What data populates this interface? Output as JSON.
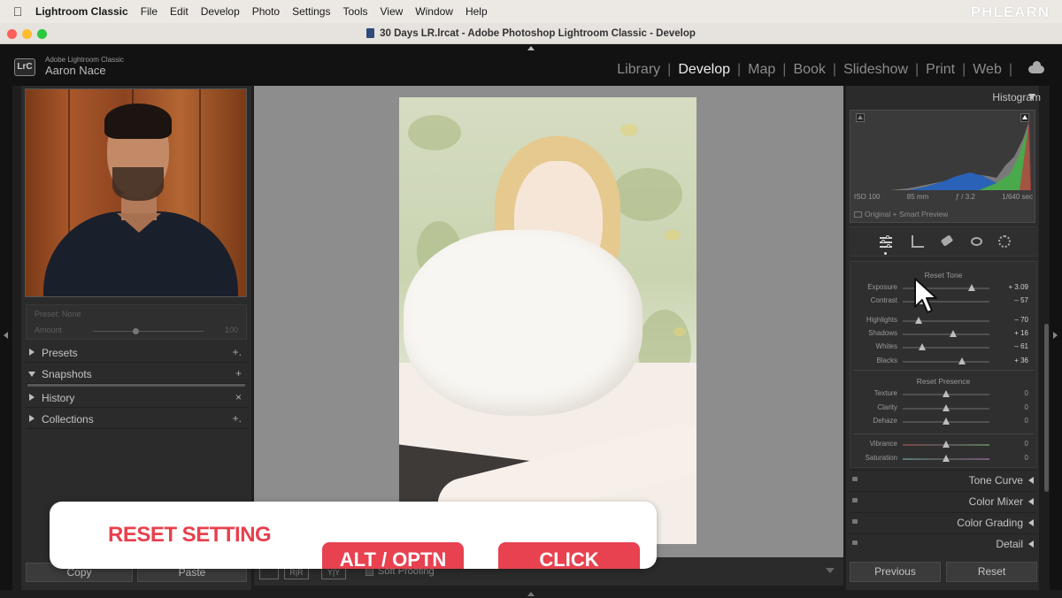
{
  "menubar": {
    "app_name": "Lightroom Classic",
    "items": [
      "File",
      "Edit",
      "Develop",
      "Photo",
      "Settings",
      "Tools",
      "View",
      "Window",
      "Help"
    ],
    "brand": "PHLEARN"
  },
  "window": {
    "title": "30 Days LR.lrcat - Adobe Photoshop Lightroom Classic - Develop"
  },
  "header": {
    "logo": "LrC",
    "app_subtitle": "Adobe Lightroom Classic",
    "user_name": "Aaron Nace",
    "modules": [
      "Library",
      "Develop",
      "Map",
      "Book",
      "Slideshow",
      "Print",
      "Web"
    ],
    "active_module": "Develop"
  },
  "left_panel": {
    "preset_label": "Preset: None",
    "amount_label": "Amount",
    "amount_value": "100",
    "sections": [
      {
        "label": "Presets",
        "action": "+.",
        "expanded": false
      },
      {
        "label": "Snapshots",
        "action": "+",
        "expanded": true
      },
      {
        "label": "History",
        "action": "×",
        "expanded": false
      },
      {
        "label": "Collections",
        "action": "+.",
        "expanded": false
      }
    ],
    "copy_label": "Copy",
    "paste_label": "Paste"
  },
  "toolbar": {
    "soft_proofing_label": "Soft Proofing",
    "view_buttons": [
      "",
      "R|R",
      "Y|Y"
    ]
  },
  "overlay": {
    "title": "RESET SETTING",
    "key_alt": "ALT / OPTN",
    "key_click": "CLICK"
  },
  "right_panel": {
    "histogram_label": "Histogram",
    "exif": {
      "iso": "ISO 100",
      "focal": "85 mm",
      "aperture": "ƒ / 3.2",
      "shutter": "1/640 sec"
    },
    "preview_label": "Original + Smart Preview",
    "tone_title": "Reset Tone",
    "tone_sliders": [
      {
        "name": "Exposure",
        "value": "+ 3.09",
        "pos": 0.8
      },
      {
        "name": "Contrast",
        "value": "– 57",
        "pos": 0.2
      },
      {
        "name": "Highlights",
        "value": "– 70",
        "pos": 0.18
      },
      {
        "name": "Shadows",
        "value": "+ 16",
        "pos": 0.58
      },
      {
        "name": "Whites",
        "value": "– 61",
        "pos": 0.22
      },
      {
        "name": "Blacks",
        "value": "+ 36",
        "pos": 0.68
      }
    ],
    "presence_title": "Reset Presence",
    "presence_sliders": [
      {
        "name": "Texture",
        "value": "0",
        "pos": 0.5
      },
      {
        "name": "Clarity",
        "value": "0",
        "pos": 0.5
      },
      {
        "name": "Dehaze",
        "value": "0",
        "pos": 0.5
      }
    ],
    "color_sliders": [
      {
        "name": "Vibrance",
        "value": "0",
        "pos": 0.5
      },
      {
        "name": "Saturation",
        "value": "0",
        "pos": 0.5
      }
    ],
    "sections": [
      "Tone Curve",
      "Color Mixer",
      "Color Grading",
      "Detail"
    ],
    "previous_label": "Previous",
    "reset_label": "Reset"
  },
  "colors": {
    "accent_red": "#e8404d",
    "panel": "#2b2b2b",
    "histogram_blue": "#2a62b8",
    "histogram_green": "#4aa94a"
  }
}
